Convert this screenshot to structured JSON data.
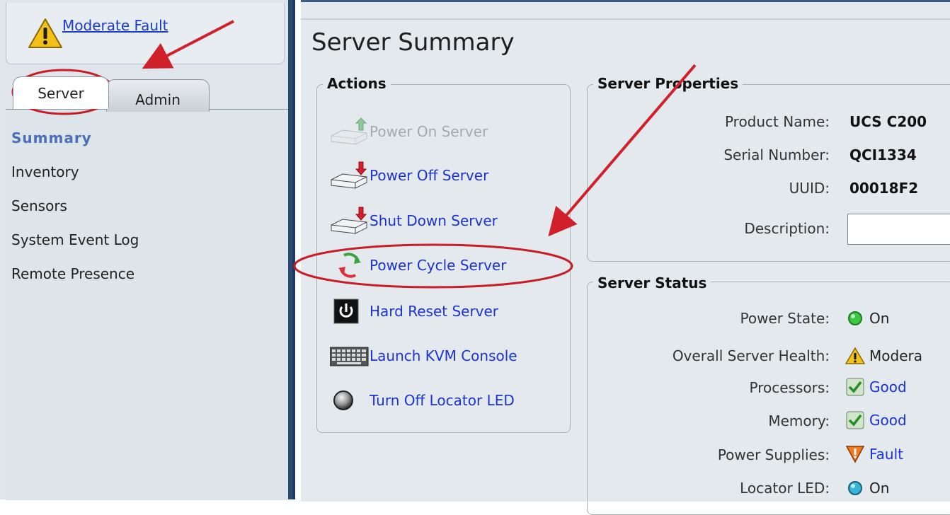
{
  "fault": {
    "label": "Moderate Fault"
  },
  "tabs": {
    "server": "Server",
    "admin": "Admin"
  },
  "nav": {
    "items": [
      "Summary",
      "Inventory",
      "Sensors",
      "System Event Log",
      "Remote Presence"
    ]
  },
  "page": {
    "title": "Server Summary"
  },
  "actions": {
    "legend": "Actions",
    "items": [
      {
        "label": "Power On Server",
        "icon": "power-on-icon",
        "enabled": false
      },
      {
        "label": "Power Off Server",
        "icon": "power-off-icon",
        "enabled": true
      },
      {
        "label": "Shut Down Server",
        "icon": "shut-down-icon",
        "enabled": true
      },
      {
        "label": "Power Cycle Server",
        "icon": "power-cycle-icon",
        "enabled": true
      },
      {
        "label": "Hard Reset Server",
        "icon": "hard-reset-icon",
        "enabled": true
      },
      {
        "label": "Launch KVM Console",
        "icon": "keyboard-icon",
        "enabled": true
      },
      {
        "label": "Turn Off Locator LED",
        "icon": "locator-led-icon",
        "enabled": true
      }
    ]
  },
  "properties": {
    "legend": "Server Properties",
    "product_name_label": "Product Name:",
    "product_name": "UCS C200",
    "serial_label": "Serial Number:",
    "serial": "QCI1334",
    "uuid_label": "UUID:",
    "uuid": "00018F2",
    "description_label": "Description:",
    "description": ""
  },
  "status": {
    "legend": "Server Status",
    "power_state_label": "Power State:",
    "power_state": "On",
    "health_label": "Overall Server Health:",
    "health": "Modera",
    "processors_label": "Processors:",
    "processors": "Good",
    "memory_label": "Memory:",
    "memory": "Good",
    "psu_label": "Power Supplies:",
    "psu": "Fault",
    "locator_label": "Locator LED:",
    "locator": "On"
  },
  "colors": {
    "link": "#1a32d6",
    "annotation": "#d0202a",
    "nav_active": "#4a6fb8",
    "header_bar": "#2a4a73"
  }
}
